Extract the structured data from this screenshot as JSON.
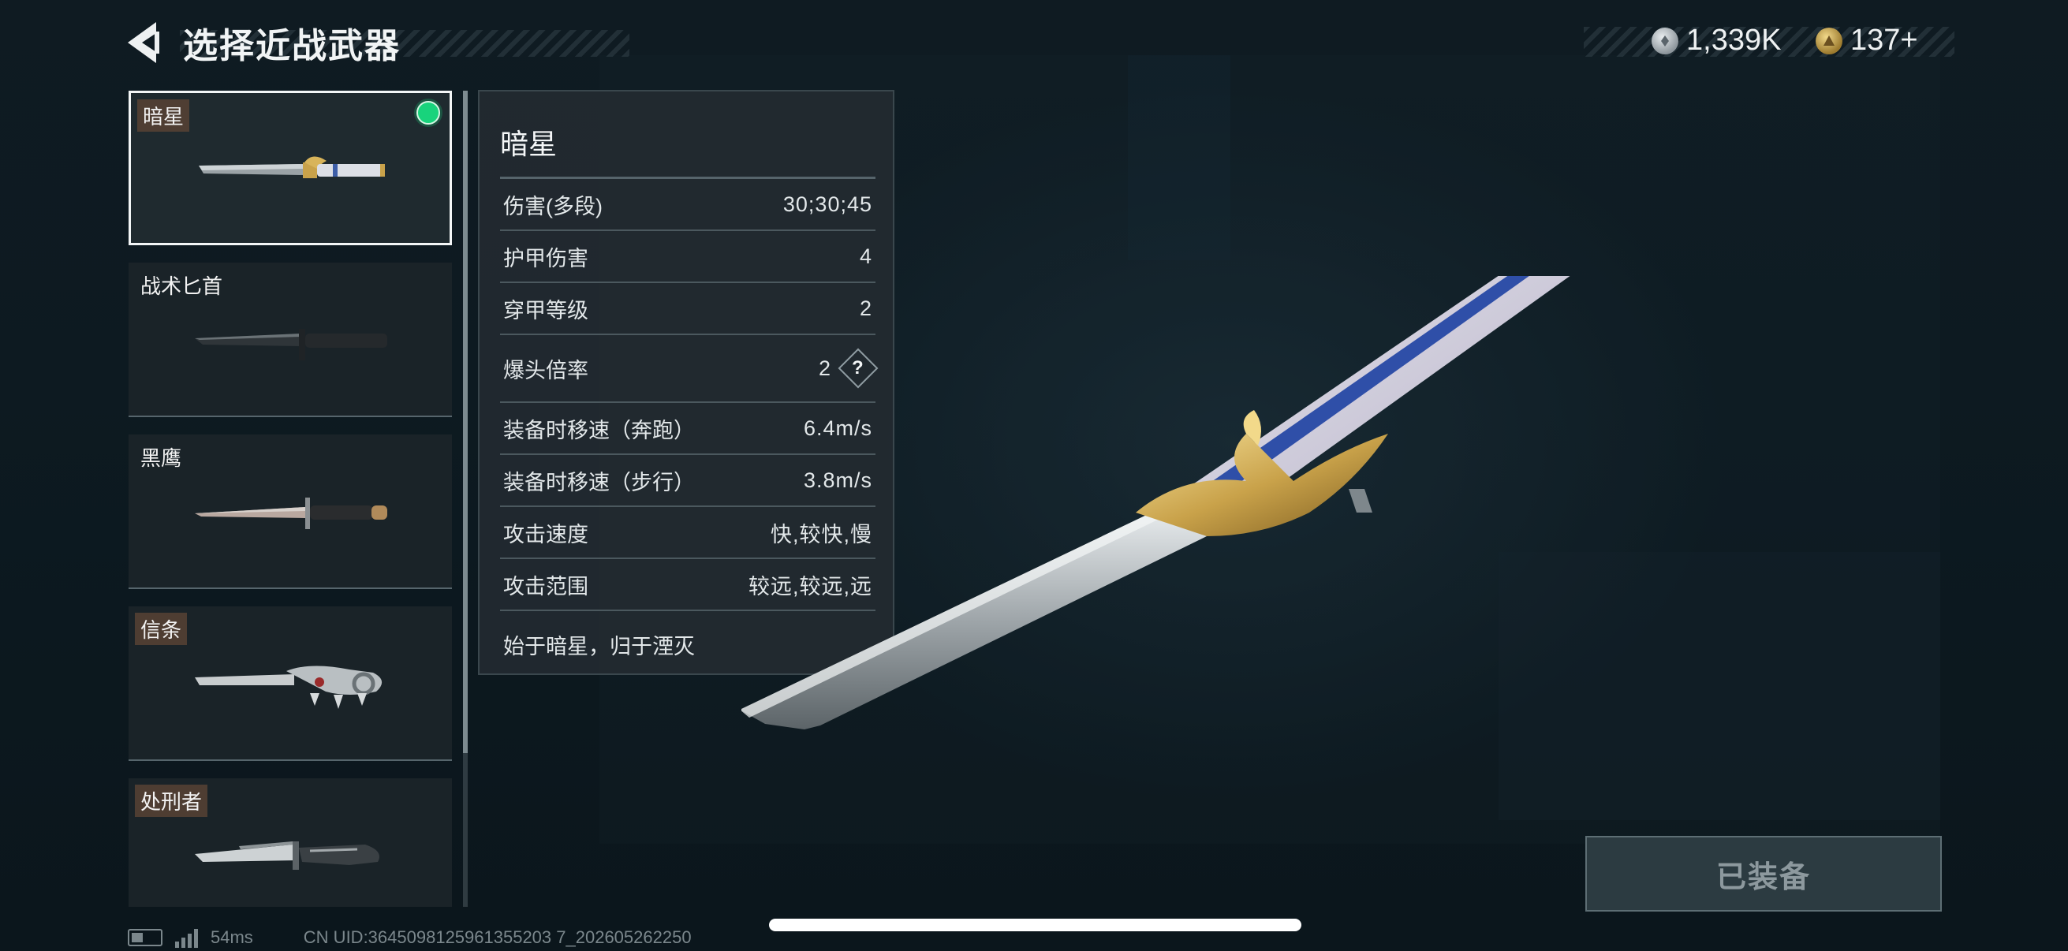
{
  "header": {
    "title": "选择近战武器"
  },
  "currency": [
    {
      "icon": "silver-coin-icon",
      "value": "1,339K"
    },
    {
      "icon": "gold-coin-icon",
      "value": "137+"
    }
  ],
  "weapons": [
    {
      "name": "暗星",
      "selected": true,
      "equipped": true,
      "tagged": true
    },
    {
      "name": "战术匕首",
      "selected": false,
      "equipped": false,
      "tagged": false
    },
    {
      "name": "黑鹰",
      "selected": false,
      "equipped": false,
      "tagged": false
    },
    {
      "name": "信条",
      "selected": false,
      "equipped": false,
      "tagged": true
    },
    {
      "name": "处刑者",
      "selected": false,
      "equipped": false,
      "tagged": true
    }
  ],
  "details": {
    "name": "暗星",
    "stats": [
      {
        "label": "伤害(多段)",
        "value": "30;30;45"
      },
      {
        "label": "护甲伤害",
        "value": "4"
      },
      {
        "label": "穿甲等级",
        "value": "2"
      },
      {
        "label": "爆头倍率",
        "value": "2",
        "help": "?"
      },
      {
        "label": "装备时移速（奔跑）",
        "value": "6.4m/s"
      },
      {
        "label": "装备时移速（步行）",
        "value": "3.8m/s"
      },
      {
        "label": "攻击速度",
        "value": "快,较快,慢"
      },
      {
        "label": "攻击范围",
        "value": "较远,较远,远"
      }
    ],
    "description": "始于暗星，归于湮灭"
  },
  "equip_button": {
    "label": "已装备"
  },
  "status_bar": {
    "ping": "54ms",
    "uid": "CN UID:3645098125961355203 7_202605262250"
  },
  "colors": {
    "equipped_dot": "#18d37c",
    "panel_bg": "#222a30",
    "accent_gold": "#c9a24a"
  }
}
